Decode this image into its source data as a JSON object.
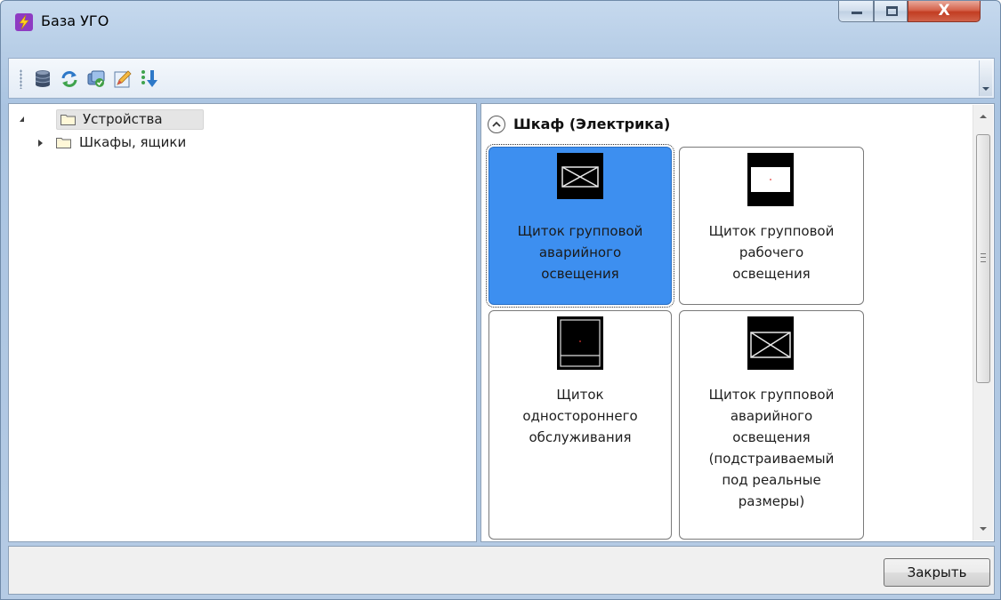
{
  "window": {
    "title": "База УГО",
    "app_icon": "lightning-icon",
    "controls": {
      "close_glyph": "X"
    }
  },
  "toolbar": {
    "buttons": [
      {
        "name": "database-icon"
      },
      {
        "name": "refresh-icon"
      },
      {
        "name": "sync-icon"
      },
      {
        "name": "edit-icon"
      },
      {
        "name": "sort-icon"
      }
    ]
  },
  "tree": {
    "items": [
      {
        "label": "Устройства",
        "expanded": true,
        "selected": true
      },
      {
        "label": "Шкафы, ящики",
        "expanded": false,
        "selected": false
      }
    ]
  },
  "group": {
    "title": "Шкаф (Электрика)",
    "tiles": [
      {
        "lines": [
          "Щиток групповой",
          "аварийного",
          "освещения"
        ],
        "selected": true
      },
      {
        "lines": [
          "Щиток групповой",
          "рабочего",
          "освещения"
        ],
        "selected": false
      },
      {
        "lines": [
          "Щиток",
          "одностороннего",
          "обслуживания"
        ],
        "selected": false
      },
      {
        "lines": [
          "Щиток групповой",
          "аварийного",
          "освещения",
          "(подстраиваемый",
          "под реальные",
          "размеры)"
        ],
        "selected": false
      }
    ]
  },
  "footer": {
    "close_label": "Закрыть"
  },
  "colors": {
    "selection": "#3d8ff0",
    "accent_icon": "#8e3bc2"
  }
}
